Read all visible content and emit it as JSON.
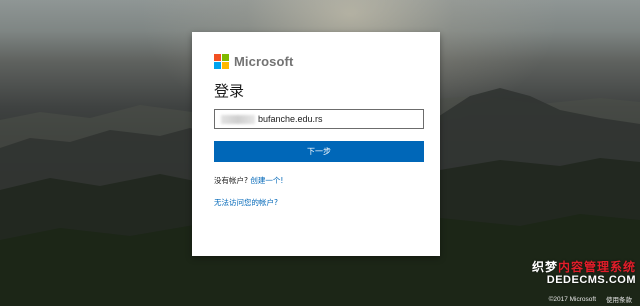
{
  "brand": {
    "name": "Microsoft",
    "logo_colors": [
      "#f25022",
      "#7fba00",
      "#00a4ef",
      "#ffb900"
    ]
  },
  "signin": {
    "title": "登录",
    "email_value": "bufanche.edu.rs",
    "next_button": "下一步",
    "no_account_text": "没有帐户?",
    "create_link": "创建一个!",
    "cant_access_link": "无法访问您的帐户?"
  },
  "footer": {
    "copyright": "©2017 Microsoft",
    "terms": "使用条款"
  },
  "watermark": {
    "line1_white": "织梦",
    "line1_red": "内容管理系统",
    "line2": "DEDECMS.COM"
  },
  "colors": {
    "accent": "#0067b8",
    "link": "#0067b8"
  }
}
